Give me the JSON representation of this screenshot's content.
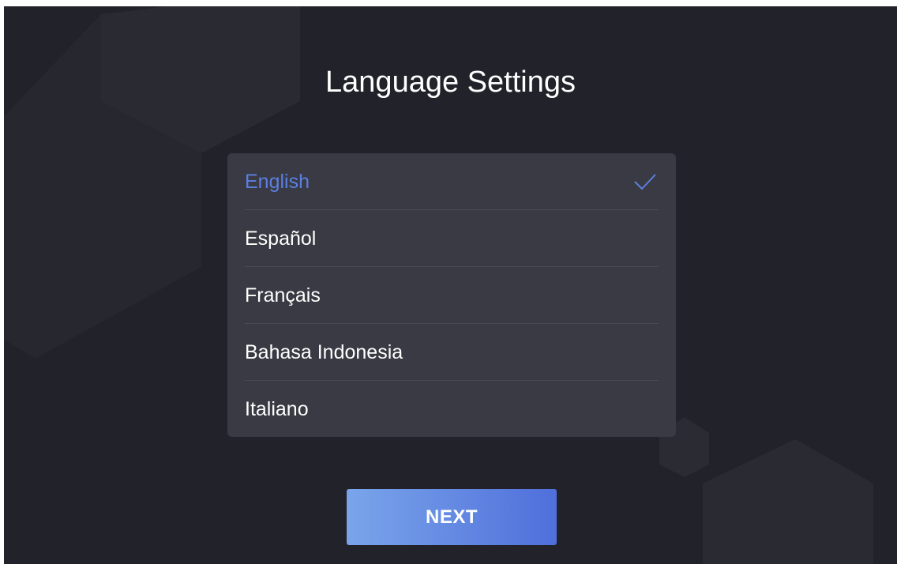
{
  "page": {
    "title": "Language Settings"
  },
  "languages": {
    "selected_index": 0,
    "items": [
      {
        "label": "English",
        "selected": true
      },
      {
        "label": "Español",
        "selected": false
      },
      {
        "label": "Français",
        "selected": false
      },
      {
        "label": "Bahasa Indonesia",
        "selected": false
      },
      {
        "label": "Italiano",
        "selected": false
      }
    ]
  },
  "footer": {
    "next_label": "NEXT"
  },
  "icons": {
    "selected_marker": "check-icon"
  },
  "colors": {
    "background": "#22222a",
    "panel": "#3a3a44",
    "divider": "#4a4a54",
    "accent": "#5b7fe0",
    "button_start": "#7aa5ea",
    "button_end": "#4f6fdb",
    "text": "#ffffff"
  }
}
